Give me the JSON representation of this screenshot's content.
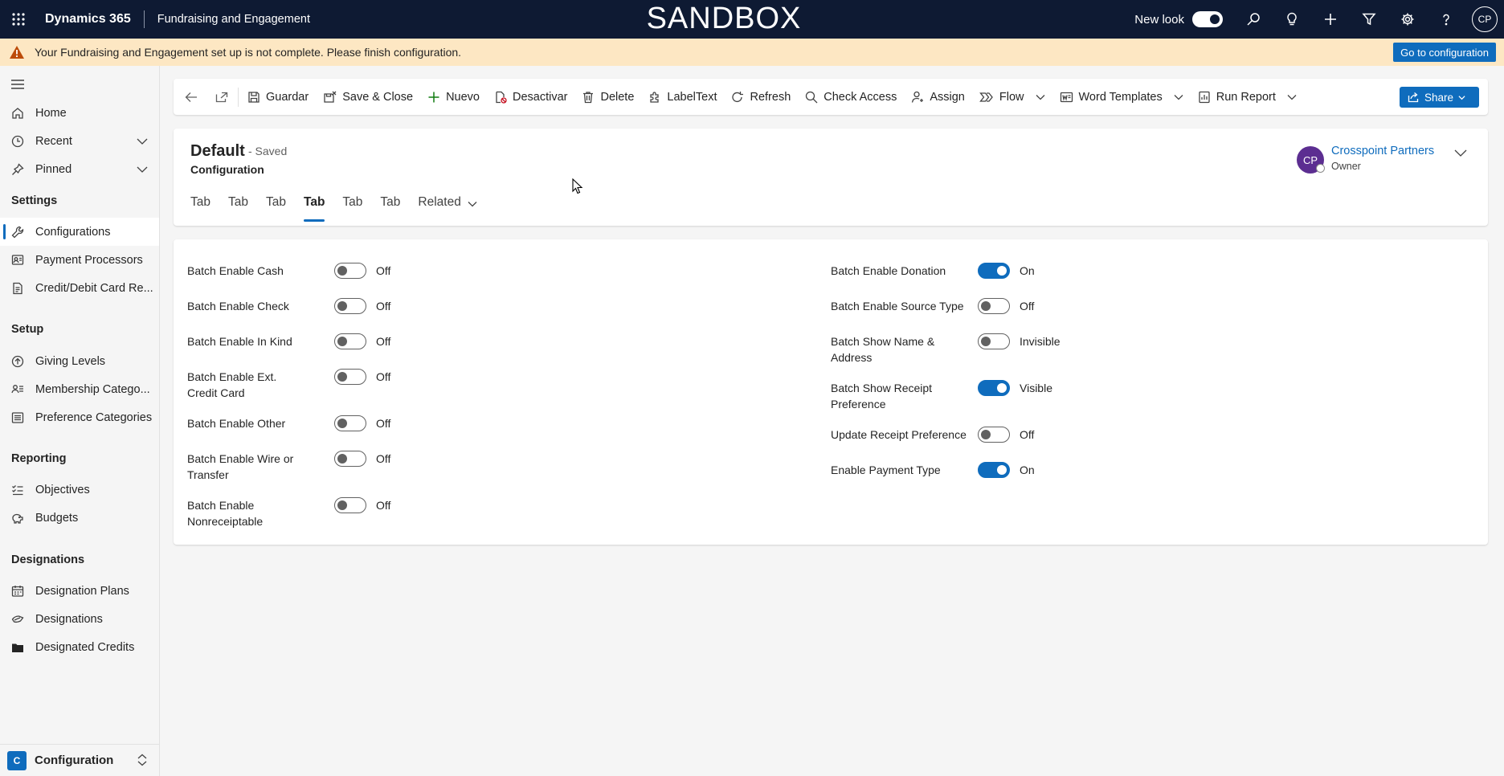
{
  "topbar": {
    "app_name": "Dynamics 365",
    "module_name": "Fundraising and Engagement",
    "environment_label": "SANDBOX",
    "new_look_label": "New look",
    "new_look_on": true,
    "user_initials": "CP",
    "icons": [
      "search-icon",
      "lightbulb-icon",
      "plus-icon",
      "filter-icon",
      "settings-icon",
      "help-icon"
    ]
  },
  "banner": {
    "message": "Your Fundraising and Engagement set up is not complete. Please finish configuration.",
    "button_label": "Go to configuration",
    "color": "#fde7c3"
  },
  "sidebar": {
    "items": [
      {
        "label": "Home",
        "icon": "home-icon"
      },
      {
        "label": "Recent",
        "icon": "clock-icon"
      },
      {
        "label": "Pinned",
        "icon": "pin-icon"
      }
    ],
    "sections": [
      {
        "title": "Settings",
        "items": [
          {
            "label": "Configurations",
            "icon": "wrench-icon",
            "active": true
          },
          {
            "label": "Payment Processors",
            "icon": "people-icon"
          },
          {
            "label": "Credit/Debit Card Re...",
            "icon": "document-icon"
          }
        ]
      },
      {
        "title": "Setup",
        "items": [
          {
            "label": "Giving Levels",
            "icon": "arrow-circle-icon"
          },
          {
            "label": "Membership Catego...",
            "icon": "membership-icon"
          },
          {
            "label": "Preference Categories",
            "icon": "list-icon"
          }
        ]
      },
      {
        "title": "Reporting",
        "items": [
          {
            "label": "Objectives",
            "icon": "checklist-icon"
          },
          {
            "label": "Budgets",
            "icon": "piggy-bank-icon"
          }
        ]
      },
      {
        "title": "Designations",
        "items": [
          {
            "label": "Designation Plans",
            "icon": "calendar-icon"
          },
          {
            "label": "Designations",
            "icon": "tag-icon"
          },
          {
            "label": "Designated Credits",
            "icon": "folder-icon"
          }
        ]
      }
    ],
    "area": {
      "badge": "C",
      "label": "Configuration"
    }
  },
  "commandbar": {
    "commands": [
      {
        "label": "Guardar",
        "icon": "save-icon"
      },
      {
        "label": "Save & Close",
        "icon": "save-close-icon"
      },
      {
        "label": "Nuevo",
        "icon": "plus-icon"
      },
      {
        "label": "Desactivar",
        "icon": "deactivate-icon"
      },
      {
        "label": "Delete",
        "icon": "trash-icon"
      },
      {
        "label": "LabelText",
        "icon": "puzzle-icon"
      },
      {
        "label": "Refresh",
        "icon": "refresh-icon"
      },
      {
        "label": "Check Access",
        "icon": "search-icon"
      },
      {
        "label": "Assign",
        "icon": "person-icon"
      },
      {
        "label": "Flow",
        "icon": "flow-icon"
      },
      {
        "label": "Word Templates",
        "icon": "word-icon"
      },
      {
        "label": "Run Report",
        "icon": "report-icon"
      }
    ],
    "share_label": "Share"
  },
  "record": {
    "title": "Default",
    "status": "- Saved",
    "entity": "Configuration",
    "tabs": [
      "Tab",
      "Tab",
      "Tab",
      "Tab",
      "Tab",
      "Tab",
      "Related"
    ],
    "active_tab_index": 3,
    "owner": {
      "initials": "CP",
      "name": "Crosspoint Partners",
      "role": "Owner",
      "avatar_color": "#5c2e91"
    }
  },
  "form": {
    "left": [
      {
        "label": "Batch Enable Cash",
        "on": false,
        "value": "Off"
      },
      {
        "label": "Batch Enable Check",
        "on": false,
        "value": "Off"
      },
      {
        "label": "Batch Enable In Kind",
        "on": false,
        "value": "Off"
      },
      {
        "label": "Batch Enable Ext. Credit Card",
        "on": false,
        "value": "Off"
      },
      {
        "label": "Batch Enable Other",
        "on": false,
        "value": "Off"
      },
      {
        "label": "Batch Enable Wire or Transfer",
        "on": false,
        "value": "Off"
      },
      {
        "label": "Batch Enable Nonreceiptable",
        "on": false,
        "value": "Off"
      }
    ],
    "right": [
      {
        "label": "Batch Enable Donation",
        "on": true,
        "value": "On"
      },
      {
        "label": "Batch Enable Source Type",
        "on": false,
        "value": "Off"
      },
      {
        "label": "Batch Show Name & Address",
        "on": false,
        "value": "Invisible"
      },
      {
        "label": "Batch Show Receipt Preference",
        "on": true,
        "value": "Visible"
      },
      {
        "label": "Update Receipt Preference",
        "on": false,
        "value": "Off"
      },
      {
        "label": "Enable Payment Type",
        "on": true,
        "value": "On"
      }
    ]
  },
  "colors": {
    "topbar": "#0e1a33",
    "accent": "#0f6cbd",
    "banner": "#fde7c3"
  }
}
